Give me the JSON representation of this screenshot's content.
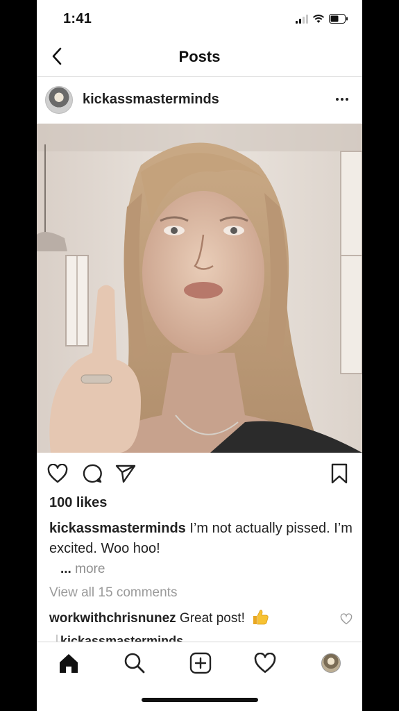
{
  "status_bar": {
    "time": "1:41",
    "signal_icon": "signal-bars-icon",
    "wifi_icon": "wifi-icon",
    "battery_icon": "battery-icon"
  },
  "nav": {
    "title": "Posts",
    "back_icon": "chevron-left-icon"
  },
  "post": {
    "username": "kickassmasterminds",
    "more_icon": "ellipsis-icon",
    "photo_description_icon": "post-photo",
    "actions": {
      "like_icon": "heart-icon",
      "comment_icon": "comment-bubble-icon",
      "share_icon": "paper-plane-icon",
      "save_icon": "bookmark-icon"
    },
    "likes": "100 likes",
    "caption_user": "kickassmasterminds",
    "caption_text": " I’m not actually pissed. I’m excited. Woo hoo!",
    "more_dots": "...",
    "more_label": " more",
    "view_comments": "View all 15 comments",
    "comment_user": "workwithchrisnunez",
    "comment_text": " Great post!",
    "comment_emoji": "thumbs-up-icon",
    "reply_user_partial": "kickassmasterminds"
  },
  "tab_bar": {
    "items": [
      {
        "name": "home",
        "icon": "home-icon"
      },
      {
        "name": "search",
        "icon": "search-icon"
      },
      {
        "name": "new-post",
        "icon": "plus-square-icon"
      },
      {
        "name": "activity",
        "icon": "heart-icon"
      },
      {
        "name": "profile",
        "icon": "avatar"
      }
    ]
  },
  "colors": {
    "text": "#262626",
    "muted": "#8e8e8e",
    "divider": "#dcdcdc",
    "background": "#ffffff"
  }
}
